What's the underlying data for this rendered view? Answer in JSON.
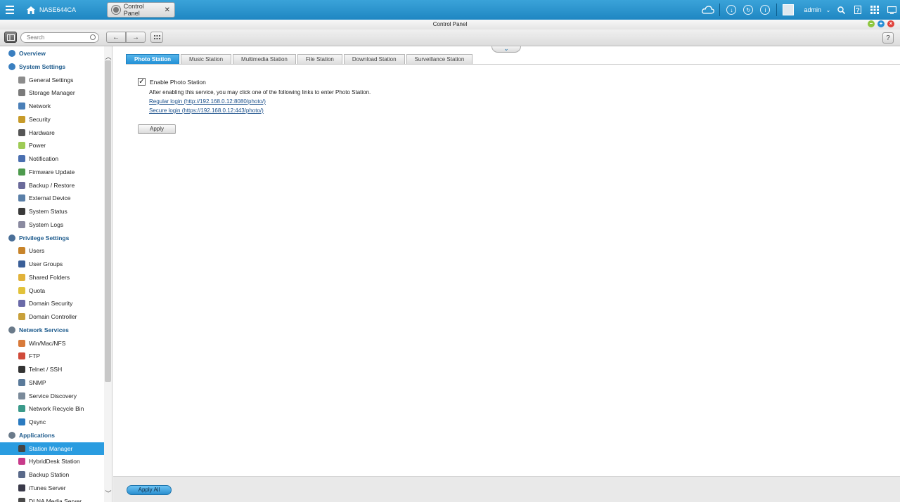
{
  "topbar": {
    "device_name": "NASE644CA",
    "open_tab": "Control Panel",
    "user": "admin"
  },
  "window": {
    "title": "Control Panel"
  },
  "toolbar": {
    "search_placeholder": "Search"
  },
  "sidebar": {
    "items": [
      {
        "label": "Overview",
        "type": "section",
        "icon": "overview-icon",
        "color": "#3a7fc0"
      },
      {
        "label": "System Settings",
        "type": "section",
        "icon": "gear-icon",
        "color": "#3a7fc0"
      },
      {
        "label": "General Settings",
        "type": "child",
        "icon": "general-settings-icon",
        "color": "#8c8c8c"
      },
      {
        "label": "Storage Manager",
        "type": "child",
        "icon": "storage-icon",
        "color": "#7a7a7a"
      },
      {
        "label": "Network",
        "type": "child",
        "icon": "network-icon",
        "color": "#4a7fb8"
      },
      {
        "label": "Security",
        "type": "child",
        "icon": "lock-icon",
        "color": "#c79b2a"
      },
      {
        "label": "Hardware",
        "type": "child",
        "icon": "hardware-icon",
        "color": "#555555"
      },
      {
        "label": "Power",
        "type": "child",
        "icon": "power-icon",
        "color": "#9ecb55"
      },
      {
        "label": "Notification",
        "type": "child",
        "icon": "notification-icon",
        "color": "#4a6fb0"
      },
      {
        "label": "Firmware Update",
        "type": "child",
        "icon": "firmware-icon",
        "color": "#4d9a4d"
      },
      {
        "label": "Backup / Restore",
        "type": "child",
        "icon": "backup-icon",
        "color": "#6a6a9a"
      },
      {
        "label": "External Device",
        "type": "child",
        "icon": "external-device-icon",
        "color": "#5a7fa8"
      },
      {
        "label": "System Status",
        "type": "child",
        "icon": "monitor-icon",
        "color": "#3a3a3a"
      },
      {
        "label": "System Logs",
        "type": "child",
        "icon": "logs-icon",
        "color": "#8a8aa0"
      },
      {
        "label": "Privilege Settings",
        "type": "section",
        "icon": "user-icon",
        "color": "#4a6f98"
      },
      {
        "label": "Users",
        "type": "child",
        "icon": "users-icon",
        "color": "#c8842a"
      },
      {
        "label": "User Groups",
        "type": "child",
        "icon": "user-groups-icon",
        "color": "#3a5f98"
      },
      {
        "label": "Shared Folders",
        "type": "child",
        "icon": "folder-icon",
        "color": "#e1b23a"
      },
      {
        "label": "Quota",
        "type": "child",
        "icon": "quota-icon",
        "color": "#e2c23a"
      },
      {
        "label": "Domain Security",
        "type": "child",
        "icon": "domain-security-icon",
        "color": "#6a6aa8"
      },
      {
        "label": "Domain Controller",
        "type": "child",
        "icon": "domain-controller-icon",
        "color": "#c8a03a"
      },
      {
        "label": "Network Services",
        "type": "section",
        "icon": "network-services-icon",
        "color": "#6a7a8a"
      },
      {
        "label": "Win/Mac/NFS",
        "type": "child",
        "icon": "win-mac-nfs-icon",
        "color": "#d87a3a"
      },
      {
        "label": "FTP",
        "type": "child",
        "icon": "ftp-icon",
        "color": "#d04a3a"
      },
      {
        "label": "Telnet / SSH",
        "type": "child",
        "icon": "terminal-icon",
        "color": "#333333"
      },
      {
        "label": "SNMP",
        "type": "child",
        "icon": "snmp-icon",
        "color": "#5a7a9a"
      },
      {
        "label": "Service Discovery",
        "type": "child",
        "icon": "service-discovery-icon",
        "color": "#7a8a9a"
      },
      {
        "label": "Network Recycle Bin",
        "type": "child",
        "icon": "recycle-bin-icon",
        "color": "#3a9a8a"
      },
      {
        "label": "Qsync",
        "type": "child",
        "icon": "qsync-icon",
        "color": "#2a7ac0"
      },
      {
        "label": "Applications",
        "type": "section",
        "icon": "applications-icon",
        "color": "#6a7a8a"
      },
      {
        "label": "Station Manager",
        "type": "child",
        "icon": "station-manager-icon",
        "color": "#444444",
        "selected": true
      },
      {
        "label": "HybridDesk Station",
        "type": "child",
        "icon": "hybriddesk-icon",
        "color": "#c83a8a"
      },
      {
        "label": "Backup Station",
        "type": "child",
        "icon": "backup-station-icon",
        "color": "#5a6a8a"
      },
      {
        "label": "iTunes Server",
        "type": "child",
        "icon": "itunes-icon",
        "color": "#3a3a4a"
      },
      {
        "label": "DLNA Media Server",
        "type": "child",
        "icon": "dlna-icon",
        "color": "#4a4a4a"
      }
    ]
  },
  "main": {
    "tabs": [
      {
        "label": "Photo Station",
        "active": true
      },
      {
        "label": "Music Station",
        "active": false
      },
      {
        "label": "Multimedia Station",
        "active": false
      },
      {
        "label": "File Station",
        "active": false
      },
      {
        "label": "Download Station",
        "active": false
      },
      {
        "label": "Surveillance Station",
        "active": false
      }
    ],
    "enable_label": "Enable Photo Station",
    "enabled": true,
    "description": "After enabling this service, you may click one of the following links to enter Photo Station.",
    "regular_login": "Regular login (http://192.168.0.12:8080/photo/)",
    "secure_login": "Secure login (https://192.168.0.12:443/photo/)",
    "apply_label": "Apply"
  },
  "footer": {
    "apply_all_label": "Apply All"
  },
  "colors": {
    "accent": "#2a9ce0",
    "section_text": "#1c5a8c",
    "link": "#1a4f8a"
  }
}
